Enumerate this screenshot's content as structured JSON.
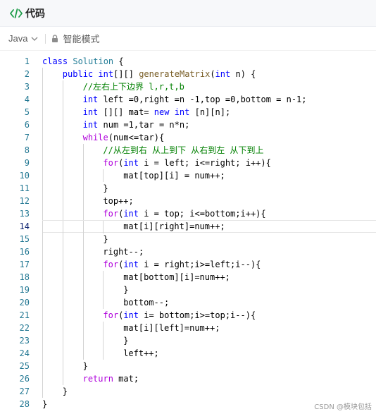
{
  "header": {
    "title": "代码",
    "icon": "code-icon"
  },
  "toolbar": {
    "language": "Java",
    "mode_label": "智能模式"
  },
  "editor": {
    "active_line": 14,
    "lines": [
      {
        "n": "1",
        "indent": 0,
        "tokens": [
          {
            "t": "class ",
            "c": "kw"
          },
          {
            "t": "Solution",
            "c": "cls"
          },
          {
            "t": " {",
            "c": ""
          }
        ]
      },
      {
        "n": "2",
        "indent": 1,
        "tokens": [
          {
            "t": "public ",
            "c": "kw"
          },
          {
            "t": "int",
            "c": "ty"
          },
          {
            "t": "[][] ",
            "c": ""
          },
          {
            "t": "generateMatrix",
            "c": "fn"
          },
          {
            "t": "(",
            "c": ""
          },
          {
            "t": "int",
            "c": "ty"
          },
          {
            "t": " n) {",
            "c": ""
          }
        ]
      },
      {
        "n": "3",
        "indent": 2,
        "tokens": [
          {
            "t": "//左右上下边界 l,r,t,b",
            "c": "cm"
          }
        ]
      },
      {
        "n": "4",
        "indent": 2,
        "tokens": [
          {
            "t": "int",
            "c": "ty"
          },
          {
            "t": " left =0,right =n -1,top =0,bottom = n-1;",
            "c": ""
          }
        ]
      },
      {
        "n": "5",
        "indent": 2,
        "tokens": [
          {
            "t": "int",
            "c": "ty"
          },
          {
            "t": " [][] mat= ",
            "c": ""
          },
          {
            "t": "new",
            "c": "kw"
          },
          {
            "t": " ",
            "c": ""
          },
          {
            "t": "int",
            "c": "ty"
          },
          {
            "t": " [n][n];",
            "c": ""
          }
        ]
      },
      {
        "n": "6",
        "indent": 2,
        "tokens": [
          {
            "t": "int",
            "c": "ty"
          },
          {
            "t": " num =1,tar = n*n;",
            "c": ""
          }
        ]
      },
      {
        "n": "7",
        "indent": 2,
        "tokens": [
          {
            "t": "while",
            "c": "ctl"
          },
          {
            "t": "(num<=tar){",
            "c": ""
          }
        ]
      },
      {
        "n": "8",
        "indent": 3,
        "tokens": [
          {
            "t": "//从左到右 从上到下 从右到左 从下到上",
            "c": "cm"
          }
        ]
      },
      {
        "n": "9",
        "indent": 3,
        "tokens": [
          {
            "t": "for",
            "c": "ctl"
          },
          {
            "t": "(",
            "c": ""
          },
          {
            "t": "int",
            "c": "ty"
          },
          {
            "t": " i = left; i<=right; i++){",
            "c": ""
          }
        ]
      },
      {
        "n": "10",
        "indent": 4,
        "tokens": [
          {
            "t": "mat[top][i] = num++;",
            "c": ""
          }
        ]
      },
      {
        "n": "11",
        "indent": 3,
        "tokens": [
          {
            "t": "}",
            "c": ""
          }
        ]
      },
      {
        "n": "12",
        "indent": 3,
        "tokens": [
          {
            "t": "top++;",
            "c": ""
          }
        ]
      },
      {
        "n": "13",
        "indent": 3,
        "tokens": [
          {
            "t": "for",
            "c": "ctl"
          },
          {
            "t": "(",
            "c": ""
          },
          {
            "t": "int",
            "c": "ty"
          },
          {
            "t": " i = top; i<=bottom;i++){",
            "c": ""
          }
        ]
      },
      {
        "n": "14",
        "indent": 4,
        "tokens": [
          {
            "t": "mat[i][right]=num++;",
            "c": ""
          }
        ]
      },
      {
        "n": "15",
        "indent": 3,
        "tokens": [
          {
            "t": "}",
            "c": ""
          }
        ]
      },
      {
        "n": "16",
        "indent": 3,
        "tokens": [
          {
            "t": "right--;",
            "c": ""
          }
        ]
      },
      {
        "n": "17",
        "indent": 3,
        "tokens": [
          {
            "t": "for",
            "c": "ctl"
          },
          {
            "t": "(",
            "c": ""
          },
          {
            "t": "int",
            "c": "ty"
          },
          {
            "t": " i = right;i>=left;i--){",
            "c": ""
          }
        ]
      },
      {
        "n": "18",
        "indent": 4,
        "tokens": [
          {
            "t": "mat[bottom][i]=num++;",
            "c": ""
          }
        ]
      },
      {
        "n": "19",
        "indent": 4,
        "tokens": [
          {
            "t": "}",
            "c": ""
          }
        ]
      },
      {
        "n": "20",
        "indent": 4,
        "tokens": [
          {
            "t": "bottom--;",
            "c": ""
          }
        ]
      },
      {
        "n": "21",
        "indent": 3,
        "tokens": [
          {
            "t": "for",
            "c": "ctl"
          },
          {
            "t": "(",
            "c": ""
          },
          {
            "t": "int",
            "c": "ty"
          },
          {
            "t": " i= bottom;i>=top;i--){",
            "c": ""
          }
        ]
      },
      {
        "n": "22",
        "indent": 4,
        "tokens": [
          {
            "t": "mat[i][left]=num++;",
            "c": ""
          }
        ]
      },
      {
        "n": "23",
        "indent": 4,
        "tokens": [
          {
            "t": "}",
            "c": ""
          }
        ]
      },
      {
        "n": "24",
        "indent": 4,
        "tokens": [
          {
            "t": "left++;",
            "c": ""
          }
        ]
      },
      {
        "n": "25",
        "indent": 2,
        "tokens": [
          {
            "t": "}",
            "c": ""
          }
        ]
      },
      {
        "n": "26",
        "indent": 2,
        "tokens": [
          {
            "t": "return",
            "c": "ctl"
          },
          {
            "t": " mat;",
            "c": ""
          }
        ]
      },
      {
        "n": "27",
        "indent": 1,
        "tokens": [
          {
            "t": "}",
            "c": ""
          }
        ]
      },
      {
        "n": "28",
        "indent": 0,
        "tokens": [
          {
            "t": "}",
            "c": ""
          }
        ]
      }
    ]
  },
  "watermark": "CSDN @模块包括",
  "colors": {
    "keyword": "#0000ff",
    "control": "#af00db",
    "function": "#795e26",
    "class": "#267f99",
    "comment": "#008000",
    "line_number": "#237893"
  }
}
